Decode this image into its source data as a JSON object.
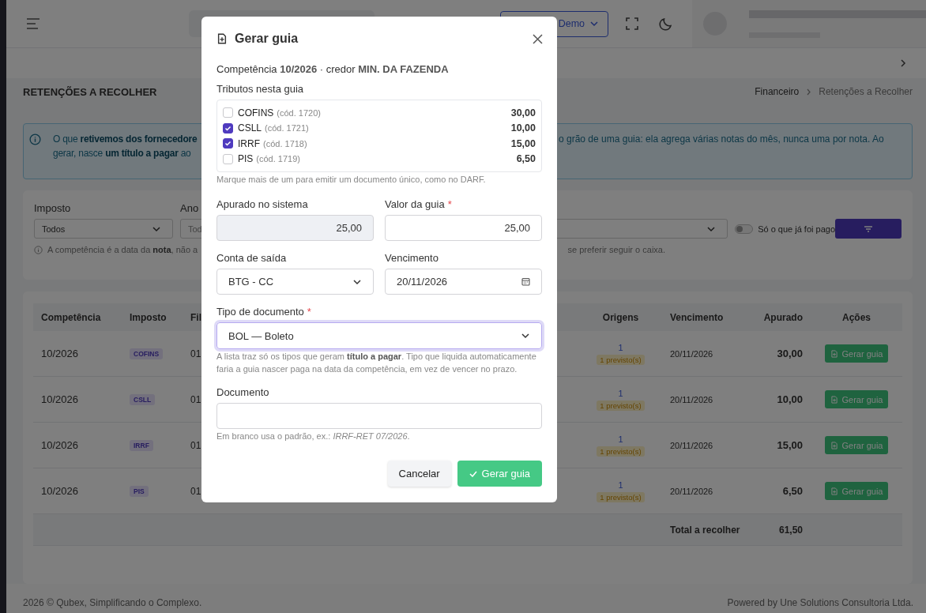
{
  "header": {
    "company_button": "Demo"
  },
  "page_title": "RETENÇÕES A RECOLHER",
  "breadcrumb": [
    "Financeiro",
    "Retenções a Recolher"
  ],
  "alert": {
    "line_1_left": "O que **retivemos dos fornecedore**",
    "line_1_right": "o grão de uma guia: ela agrega várias notas do mês, nunca uma por nota. Ao",
    "line_2_left": "gerar, nasce **um título a pagar** ao"
  },
  "filters": {
    "fields": [
      {
        "label": "Imposto",
        "value": "Todos"
      },
      {
        "label": "Ano",
        "value": "Tod"
      }
    ],
    "toggle": {
      "label": "Só o que já foi pago",
      "on": false
    },
    "hint_left": "A competência é a data da **nota**, não a",
    "hint_right": "se preferir seguir o caixa."
  },
  "table": {
    "columns": [
      "Competência",
      "Imposto",
      "Fil",
      "Origens",
      "Vencimento",
      "Apurado",
      "Ações"
    ],
    "rows": [
      {
        "competencia": "10/2026",
        "imposto": "COFINS",
        "column_3": "01",
        "origens": "1",
        "origens_badge": "1 previsto(s)",
        "vencimento": "20/11/2026",
        "apurado": "30,00",
        "action": "Gerar guia"
      },
      {
        "competencia": "10/2026",
        "imposto": "CSLL",
        "column_3": "01",
        "origens": "1",
        "origens_badge": "1 previsto(s)",
        "vencimento": "20/11/2026",
        "apurado": "10,00",
        "action": "Gerar guia"
      },
      {
        "competencia": "10/2026",
        "imposto": "IRRF",
        "column_3": "01",
        "origens": "1",
        "origens_badge": "1 previsto(s)",
        "vencimento": "20/11/2026",
        "apurado": "15,00",
        "action": "Gerar guia"
      },
      {
        "competencia": "10/2026",
        "imposto": "PIS",
        "column_3": "01",
        "origens": "1",
        "origens_badge": "1 previsto(s)",
        "vencimento": "20/11/2026",
        "apurado": "6,50",
        "action": "Gerar guia"
      }
    ],
    "total_label": "Total a recolher",
    "total": "61,50"
  },
  "footer": {
    "left": "2026 © Qubex, Simplificando o Complexo.",
    "right": "Powered by Une Solutions Consultoria Ltda."
  },
  "modal": {
    "title": "Gerar guia",
    "summary": "Competência **10/2026** · credor **MIN. DA FAZENDA**",
    "tributos_label": "Tributos nesta guia",
    "tributos": [
      {
        "name": "COFINS",
        "code": "(cód. 1720)",
        "amount": "30,00",
        "checked": false
      },
      {
        "name": "CSLL",
        "code": "(cód. 1721)",
        "amount": "10,00",
        "checked": true
      },
      {
        "name": "IRRF",
        "code": "(cód. 1718)",
        "amount": "15,00",
        "checked": true
      },
      {
        "name": "PIS",
        "code": "(cód. 1719)",
        "amount": "6,50",
        "checked": false
      }
    ],
    "tributos_hint": "Marque mais de um para emitir um documento único, como no DARF.",
    "field_rows": [
      [
        {
          "kind": "readonly",
          "label": "Apurado no sistema",
          "value": "25,00"
        },
        {
          "kind": "number",
          "label": "Valor da guia",
          "required_mark": "*",
          "value": "25,00"
        }
      ],
      [
        {
          "kind": "select",
          "label": "Conta de saída",
          "value": "BTG - CC"
        },
        {
          "kind": "date",
          "label": "Vencimento",
          "value": "20/11/2026"
        }
      ],
      [
        {
          "kind": "select",
          "label": "Tipo de documento",
          "required_mark": "*",
          "value": "BOL — Boleto",
          "focused": true,
          "hint": "A lista traz só os tipos que geram **título a pagar**. Tipo que liquida automaticamente faria a guia nascer paga na data da competência, em vez de vencer no prazo."
        }
      ],
      [
        {
          "kind": "text",
          "label": "Documento",
          "hint": "Em branco usa o padrão, ex.: *IRRF-RET 07/2026*."
        }
      ]
    ],
    "buttons": [
      {
        "kind": "secondary",
        "label": "Cancelar"
      },
      {
        "kind": "primary",
        "label": "Gerar guia"
      }
    ]
  }
}
